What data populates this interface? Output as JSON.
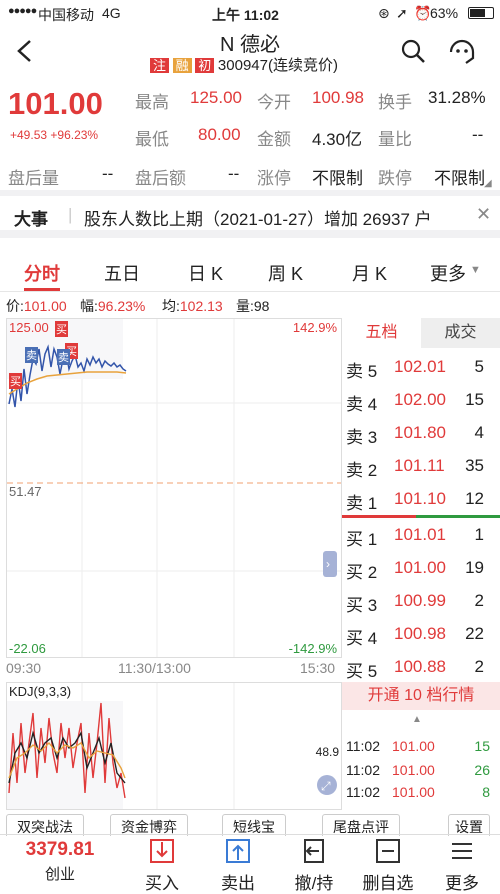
{
  "status_bar": {
    "carrier": "中国移动",
    "network": "4G",
    "time": "上午 11:02",
    "battery": "63%"
  },
  "header": {
    "title": "N 德必",
    "tags": [
      "注",
      "融",
      "初"
    ],
    "subtitle": "300947(连续竞价)"
  },
  "quote": {
    "price": "101.00",
    "change": "+49.53",
    "change_pct": "+96.23%",
    "high_label": "最高",
    "high": "125.00",
    "open_label": "今开",
    "open": "100.98",
    "turnover_label": "换手",
    "turnover": "31.28%",
    "low_label": "最低",
    "low": "80.00",
    "amount_label": "金额",
    "amount": "4.30亿",
    "ratio_label": "量比",
    "ratio": "--",
    "after_vol_label": "盘后量",
    "after_vol": "--",
    "after_amt_label": "盘后额",
    "after_amt": "--",
    "limit_up_label": "涨停",
    "limit_up": "不限制",
    "limit_down_label": "跌停",
    "limit_down": "不限制"
  },
  "event": {
    "label": "大事",
    "text": "股东人数比上期（2021-01-27）增加 26937 户"
  },
  "tabs": [
    "分时",
    "五日",
    "日 K",
    "周 K",
    "月 K",
    "更多"
  ],
  "infoline": {
    "price_label": "价:",
    "price": "101.00",
    "range_label": "幅:",
    "range": "96.23%",
    "avg_label": "均:",
    "avg": "102.13",
    "vol_label": "量:",
    "vol": "98"
  },
  "chart_labels": {
    "top_left": "125.00",
    "top_right": "142.9%",
    "mid_left": "51.47",
    "bottom_left": "-22.06",
    "bottom_right": "-142.9%",
    "kdj_title": "KDJ(9,3,3)",
    "kdj_value": "48.9"
  },
  "markers": [
    "买",
    "卖",
    "买",
    "卖",
    "买"
  ],
  "time_axis": [
    "09:30",
    "11:30/13:00",
    "15:30"
  ],
  "orderbook": {
    "tab_active": "五档",
    "tab_other": "成交",
    "asks": [
      {
        "label": "卖 5",
        "price": "102.01",
        "vol": "5"
      },
      {
        "label": "卖 4",
        "price": "102.00",
        "vol": "15"
      },
      {
        "label": "卖 3",
        "price": "101.80",
        "vol": "4"
      },
      {
        "label": "卖 2",
        "price": "101.11",
        "vol": "35"
      },
      {
        "label": "卖 1",
        "price": "101.10",
        "vol": "12"
      }
    ],
    "bids": [
      {
        "label": "买 1",
        "price": "101.01",
        "vol": "1"
      },
      {
        "label": "买 2",
        "price": "101.00",
        "vol": "19"
      },
      {
        "label": "买 3",
        "price": "100.99",
        "vol": "2"
      },
      {
        "label": "买 4",
        "price": "100.98",
        "vol": "22"
      },
      {
        "label": "买 5",
        "price": "100.88",
        "vol": "2"
      }
    ],
    "open_level10": "开通 10 档行情",
    "trades": [
      {
        "time": "11:02",
        "price": "101.00",
        "vol": "15"
      },
      {
        "time": "11:02",
        "price": "101.00",
        "vol": "26"
      },
      {
        "time": "11:02",
        "price": "101.00",
        "vol": "8"
      }
    ]
  },
  "toolbar": [
    "双突战法",
    "资金博弈",
    "短线宝",
    "尾盘点评",
    "设置"
  ],
  "bottom_nav": {
    "index_value": "3379.81",
    "index_name": "创业",
    "items": [
      "买入",
      "卖出",
      "撤/持",
      "删自选",
      "更多"
    ]
  },
  "colors": {
    "up": "#e03a3a",
    "down": "#2f9a3f",
    "avg_line": "#e8a23c",
    "price_line": "#3355aa"
  }
}
